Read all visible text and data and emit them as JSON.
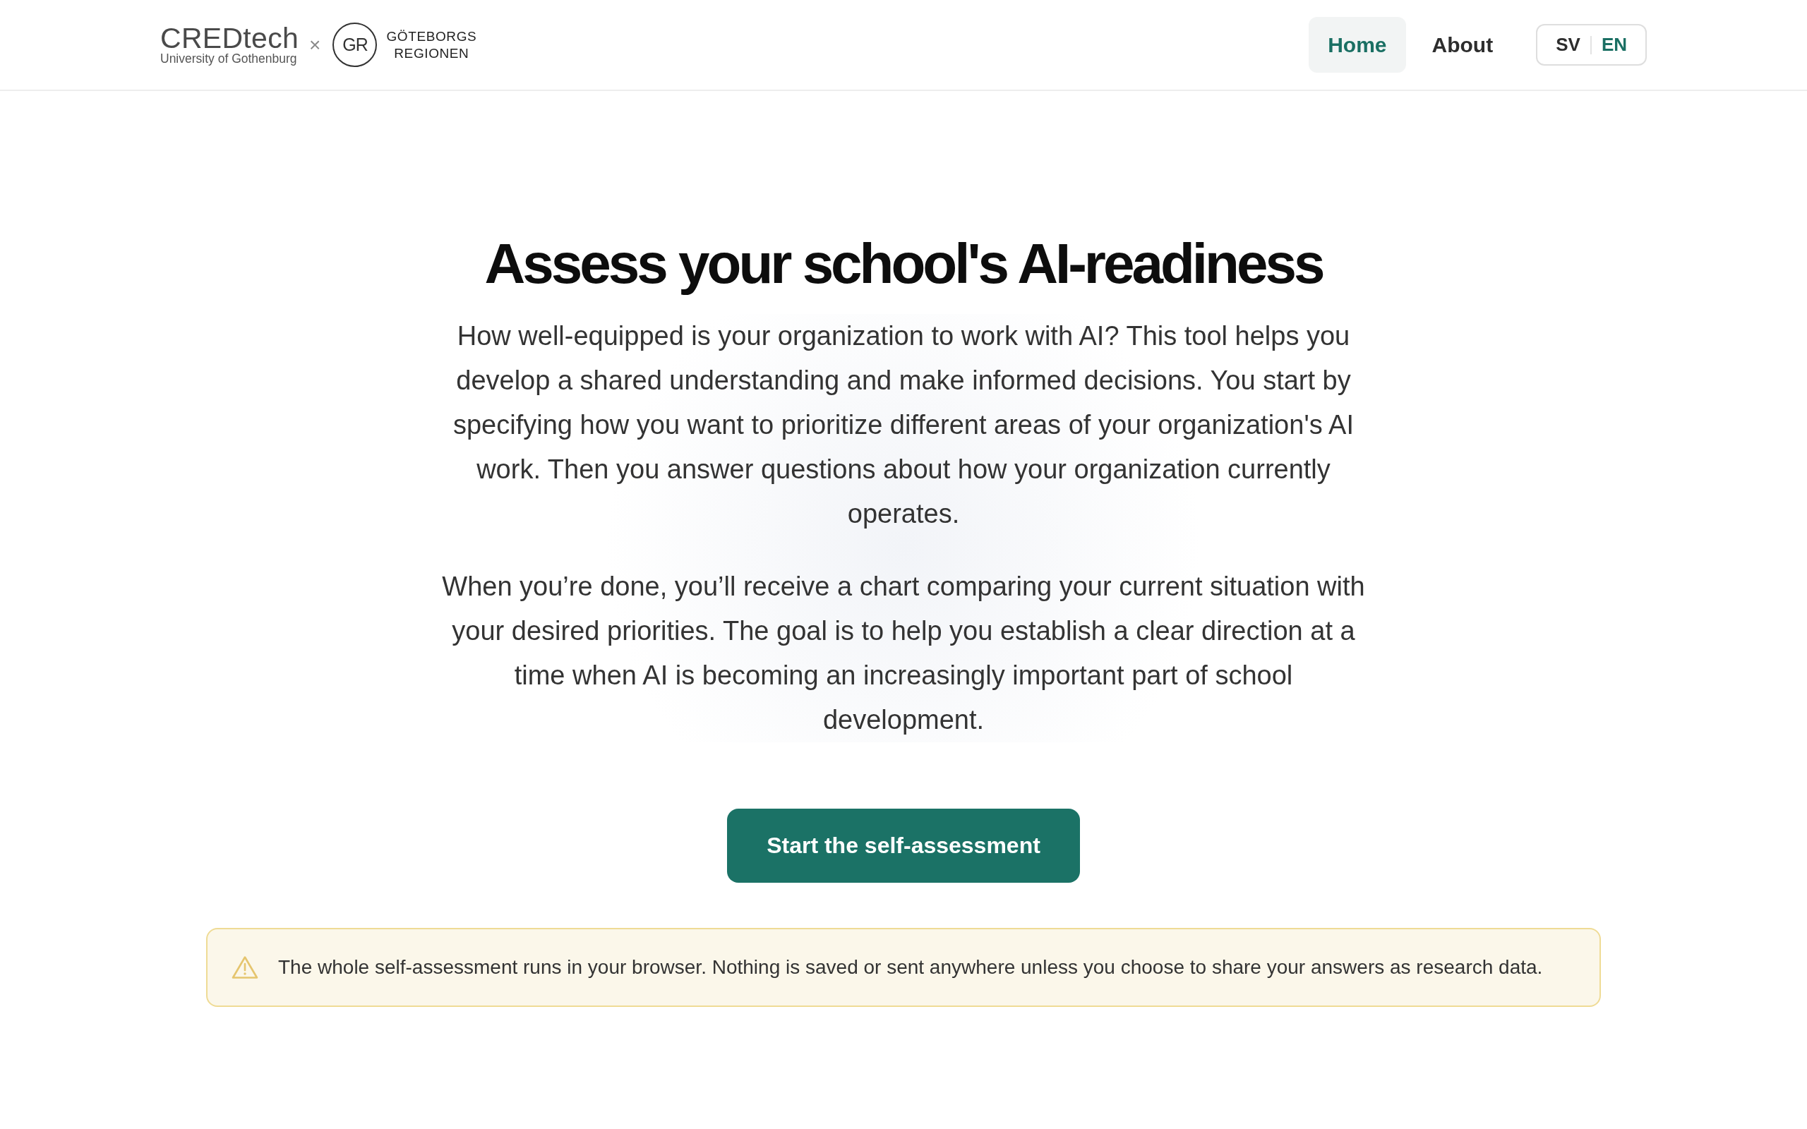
{
  "header": {
    "logo": {
      "wordmark": "CREDtech",
      "subtitle": "University of Gothenburg",
      "separator": "×",
      "monogram": "GR",
      "partner_lines": [
        "GÖTEBORGS",
        "REGIONEN"
      ]
    },
    "nav": [
      {
        "label": "Home",
        "selected": true
      },
      {
        "label": "About",
        "selected": false
      }
    ],
    "language_switch": [
      {
        "label": "SV",
        "selected": false
      },
      {
        "label": "EN",
        "selected": true
      }
    ]
  },
  "hero": {
    "title": "Assess your school's AI-readiness",
    "paragraphs": [
      "How well-equipped is your organization to work with AI? This tool helps you develop a shared understanding and make informed decisions. You start by specifying how you want to prioritize different areas of your organization's AI work. Then you answer questions about how your organization currently operates.",
      "When you’re done, you’ll receive a chart comparing your current situation with your desired priorities. The goal is to help you establish a clear direction at a time when AI is becoming an increasingly important part of school development."
    ],
    "button": "Start the self-assessment"
  },
  "notice": {
    "text": "The whole self-assessment runs in your browser. Nothing is saved or sent anywhere unless you choose to share your answers as research data."
  }
}
